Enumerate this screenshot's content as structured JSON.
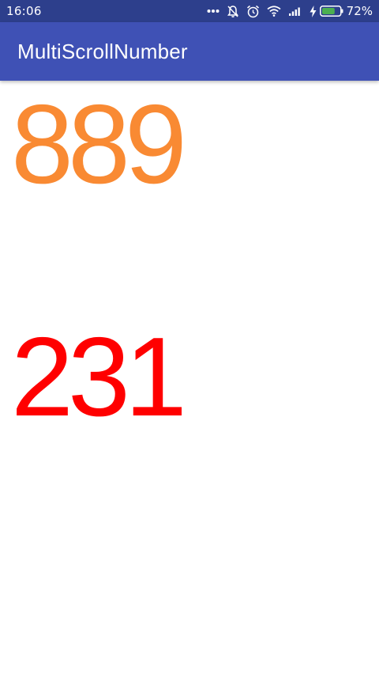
{
  "status_bar": {
    "time": "16:06",
    "battery_percent": "72%",
    "battery_level": 0.72,
    "icons": [
      "more-dots-icon",
      "mute-bell-icon",
      "alarm-clock-icon",
      "wifi-icon",
      "signal-icon",
      "charging-bolt-icon",
      "battery-icon"
    ],
    "background": "#2d3f8c"
  },
  "app_bar": {
    "title": "MultiScrollNumber",
    "background": "#3f51b5"
  },
  "numbers": {
    "first": {
      "value": "889",
      "color": "#f98a33"
    },
    "second": {
      "value": "231",
      "color": "#ff0000"
    }
  }
}
